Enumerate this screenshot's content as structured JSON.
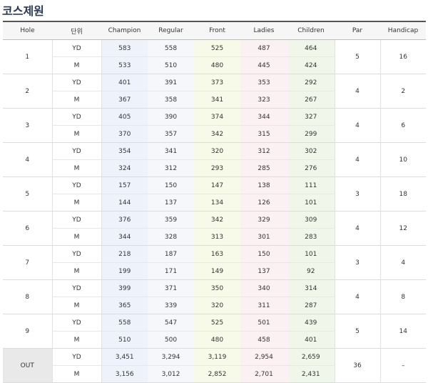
{
  "page_title": "코스제원",
  "headers": [
    "Hole",
    "단위",
    "Champion",
    "Regular",
    "Front",
    "Ladies",
    "Children",
    "Par",
    "Handicap"
  ],
  "holes": [
    {
      "hole": "1",
      "par": "5",
      "handicap": "16",
      "yd": [
        "583",
        "558",
        "525",
        "487",
        "464"
      ],
      "m": [
        "533",
        "510",
        "480",
        "445",
        "424"
      ]
    },
    {
      "hole": "2",
      "par": "4",
      "handicap": "2",
      "yd": [
        "401",
        "391",
        "373",
        "353",
        "292"
      ],
      "m": [
        "367",
        "358",
        "341",
        "323",
        "267"
      ]
    },
    {
      "hole": "3",
      "par": "4",
      "handicap": "6",
      "yd": [
        "405",
        "390",
        "374",
        "344",
        "327"
      ],
      "m": [
        "370",
        "357",
        "342",
        "315",
        "299"
      ]
    },
    {
      "hole": "4",
      "par": "4",
      "handicap": "10",
      "yd": [
        "354",
        "341",
        "320",
        "312",
        "302"
      ],
      "m": [
        "324",
        "312",
        "293",
        "285",
        "276"
      ]
    },
    {
      "hole": "5",
      "par": "3",
      "handicap": "18",
      "yd": [
        "157",
        "150",
        "147",
        "138",
        "111"
      ],
      "m": [
        "144",
        "137",
        "134",
        "126",
        "101"
      ]
    },
    {
      "hole": "6",
      "par": "4",
      "handicap": "12",
      "yd": [
        "376",
        "359",
        "342",
        "329",
        "309"
      ],
      "m": [
        "344",
        "328",
        "313",
        "301",
        "283"
      ]
    },
    {
      "hole": "7",
      "par": "3",
      "handicap": "4",
      "yd": [
        "218",
        "187",
        "163",
        "150",
        "101"
      ],
      "m": [
        "199",
        "171",
        "149",
        "137",
        "92"
      ]
    },
    {
      "hole": "8",
      "par": "4",
      "handicap": "8",
      "yd": [
        "399",
        "371",
        "350",
        "340",
        "314"
      ],
      "m": [
        "365",
        "339",
        "320",
        "311",
        "287"
      ]
    },
    {
      "hole": "9",
      "par": "5",
      "handicap": "14",
      "yd": [
        "558",
        "547",
        "525",
        "501",
        "439"
      ],
      "m": [
        "510",
        "500",
        "480",
        "458",
        "401"
      ]
    },
    {
      "hole": "OUT",
      "par": "36",
      "handicap": "–",
      "yd": [
        "3,451",
        "3,294",
        "3,119",
        "2,954",
        "2,659"
      ],
      "m": [
        "3,156",
        "3,012",
        "2,852",
        "2,701",
        "2,431"
      ]
    }
  ],
  "unit_labels": {
    "yd": "YD",
    "m": "M"
  },
  "colors": {
    "title": "#2a3b55",
    "champion": "#eef3fb",
    "regular": "#f6f7fb",
    "front": "#f7f9e9",
    "ladies": "#fbf0f2",
    "children": "#f1f6ea",
    "out_row": "#e9e9e9"
  }
}
